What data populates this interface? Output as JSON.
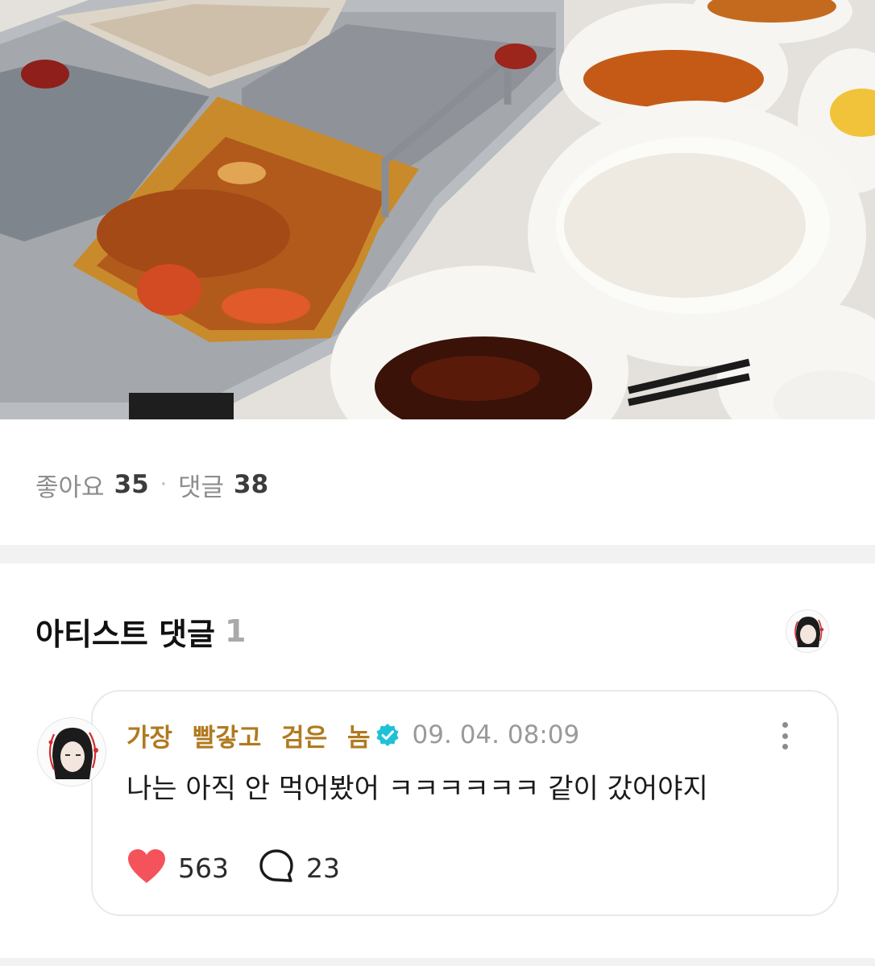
{
  "post": {
    "photo_icon": "hotpot-photo",
    "stats": {
      "likes_label": "좋아요",
      "likes_count": "35",
      "separator": "·",
      "comments_label": "댓글",
      "comments_count": "38"
    }
  },
  "artist_comments": {
    "title": "아티스트 댓글",
    "count": "1",
    "comment": {
      "author": "가장 빨갛고 검은 놈",
      "timestamp": "09. 04. 08:09",
      "text": "나는 아직 안 먹어봤어 ㅋㅋㅋㅋㅋㅋ 같이 갔어야지",
      "like_count": "563",
      "reply_count": "23",
      "verified_icon": "verified-badge-icon"
    }
  },
  "colors": {
    "author": "#b07a1f",
    "heart": "#f4535c",
    "verified": "#1fc1d6"
  }
}
